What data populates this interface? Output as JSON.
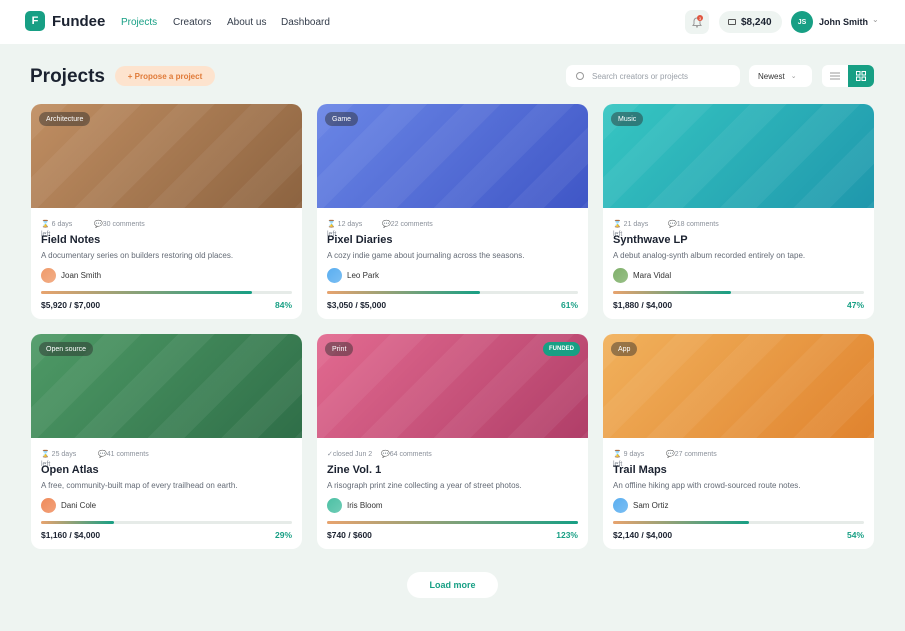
{
  "brand": {
    "logo_letter": "F",
    "name": "Fundee",
    "accent": "#179f84"
  },
  "nav": [
    {
      "label": "Projects",
      "active": true
    },
    {
      "label": "Creators",
      "active": false
    },
    {
      "label": "About us",
      "active": false
    },
    {
      "label": "Dashboard",
      "active": false
    }
  ],
  "header": {
    "notification_icon": "bell-icon",
    "notification_count": "3",
    "wallet_icon": "wallet-icon",
    "balance": "$8,240",
    "user_initials": "JS",
    "user_name": "John Smith"
  },
  "toolbar": {
    "page_title": "Projects",
    "propose_label": "+ Propose a project",
    "search_placeholder": "Search creators or projects",
    "sort_label": "Newest",
    "view_list_icon": "list-icon",
    "view_grid_icon": "grid-icon"
  },
  "projects": [
    {
      "category": "Architecture",
      "time_left": "6 days left",
      "comments": "30 comments",
      "title": "Field Notes",
      "description": "A documentary series on builders restoring old places.",
      "creator": "Joan Smith",
      "raised": "$5,920 / $7,000",
      "percent": "84%",
      "progress": 0.84,
      "funded_badge": "",
      "cover_from": "#c08e62",
      "cover_to": "#8c6340",
      "avatar_color": "#ef9a6a"
    },
    {
      "category": "Game",
      "time_left": "12 days left",
      "comments": "22 comments",
      "title": "Pixel Diaries",
      "description": "A cozy indie game about journaling across the seasons.",
      "creator": "Leo Park",
      "raised": "$3,050 / $5,000",
      "percent": "61%",
      "progress": 0.61,
      "funded_badge": "",
      "cover_from": "#6a86e6",
      "cover_to": "#3f56c6",
      "avatar_color": "#5aaef0"
    },
    {
      "category": "Music",
      "time_left": "21 days left",
      "comments": "18 comments",
      "title": "Synthwave LP",
      "description": "A debut analog-synth album recorded entirely on tape.",
      "creator": "Mara Vidal",
      "raised": "$1,880 / $4,000",
      "percent": "47%",
      "progress": 0.47,
      "funded_badge": "",
      "cover_from": "#36c6c2",
      "cover_to": "#1f97ac",
      "avatar_color": "#7fb06a"
    },
    {
      "category": "Open source",
      "time_left": "25 days left",
      "comments": "41 comments",
      "title": "Open Atlas",
      "description": "A free, community-built map of every trailhead on earth.",
      "creator": "Dani Cole",
      "raised": "$1,160 / $4,000",
      "percent": "29%",
      "progress": 0.29,
      "funded_badge": "",
      "cover_from": "#4e9a66",
      "cover_to": "#2f6e48",
      "avatar_color": "#ef8a5a"
    },
    {
      "category": "Print",
      "time_left": "closed Jun 2",
      "comments": "64 comments",
      "title": "Zine Vol. 1",
      "description": "A risograph print zine collecting a year of street photos.",
      "creator": "Iris Bloom",
      "raised": "$740 / $600",
      "percent": "123%",
      "progress": 1.0,
      "funded_badge": "FUNDED",
      "cover_from": "#e26a90",
      "cover_to": "#b03e68",
      "avatar_color": "#4cc0a4"
    },
    {
      "category": "App",
      "time_left": "9 days left",
      "comments": "27 comments",
      "title": "Trail Maps",
      "description": "An offline hiking app with crowd-sourced route notes.",
      "creator": "Sam Ortiz",
      "raised": "$2,140 / $4,000",
      "percent": "54%",
      "progress": 0.54,
      "funded_badge": "",
      "cover_from": "#f1b15c",
      "cover_to": "#e0832e",
      "avatar_color": "#5aaef0"
    }
  ],
  "load_more_label": "Load more"
}
